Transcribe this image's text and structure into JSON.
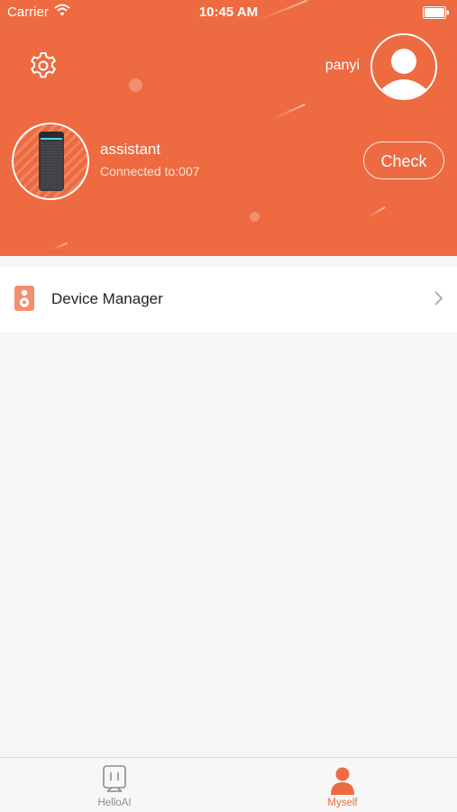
{
  "status_bar": {
    "carrier": "Carrier",
    "time": "10:45 AM"
  },
  "header": {
    "background_color": "#ee6a40",
    "settings_icon": "gear-icon",
    "username": "panyi",
    "avatar_icon": "user-avatar-icon"
  },
  "device": {
    "name": "assistant",
    "connection": "Connected to:007",
    "check_label": "Check"
  },
  "menu": {
    "items": [
      {
        "label": "Device Manager",
        "icon": "speaker-icon"
      }
    ]
  },
  "tabbar": {
    "tabs": [
      {
        "label": "HelloAI",
        "icon": "robot-icon",
        "active": false
      },
      {
        "label": "Myself",
        "icon": "person-icon",
        "active": true
      }
    ],
    "accent_color": "#ee6a40"
  }
}
